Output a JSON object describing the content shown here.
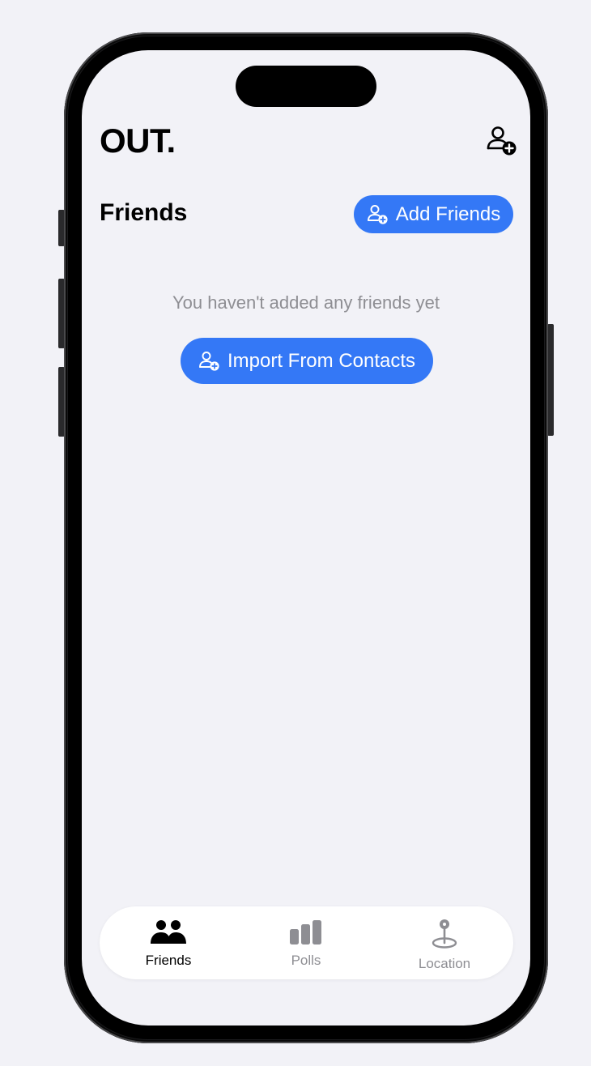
{
  "app": {
    "title": "OUT."
  },
  "friends": {
    "section_title": "Friends",
    "add_button_label": "Add Friends",
    "empty_message": "You haven't added any friends yet",
    "import_button_label": "Import From Contacts"
  },
  "tabs": [
    {
      "label": "Friends",
      "icon": "two-people-icon",
      "active": true
    },
    {
      "label": "Polls",
      "icon": "bar-chart-icon",
      "active": false
    },
    {
      "label": "Location",
      "icon": "map-pin-icon",
      "active": false
    }
  ],
  "colors": {
    "accent": "#3478f6",
    "background": "#f2f2f7",
    "secondary_text": "#8e8e93",
    "active_tab": "#000000",
    "inactive_tab": "#8e8e93"
  }
}
